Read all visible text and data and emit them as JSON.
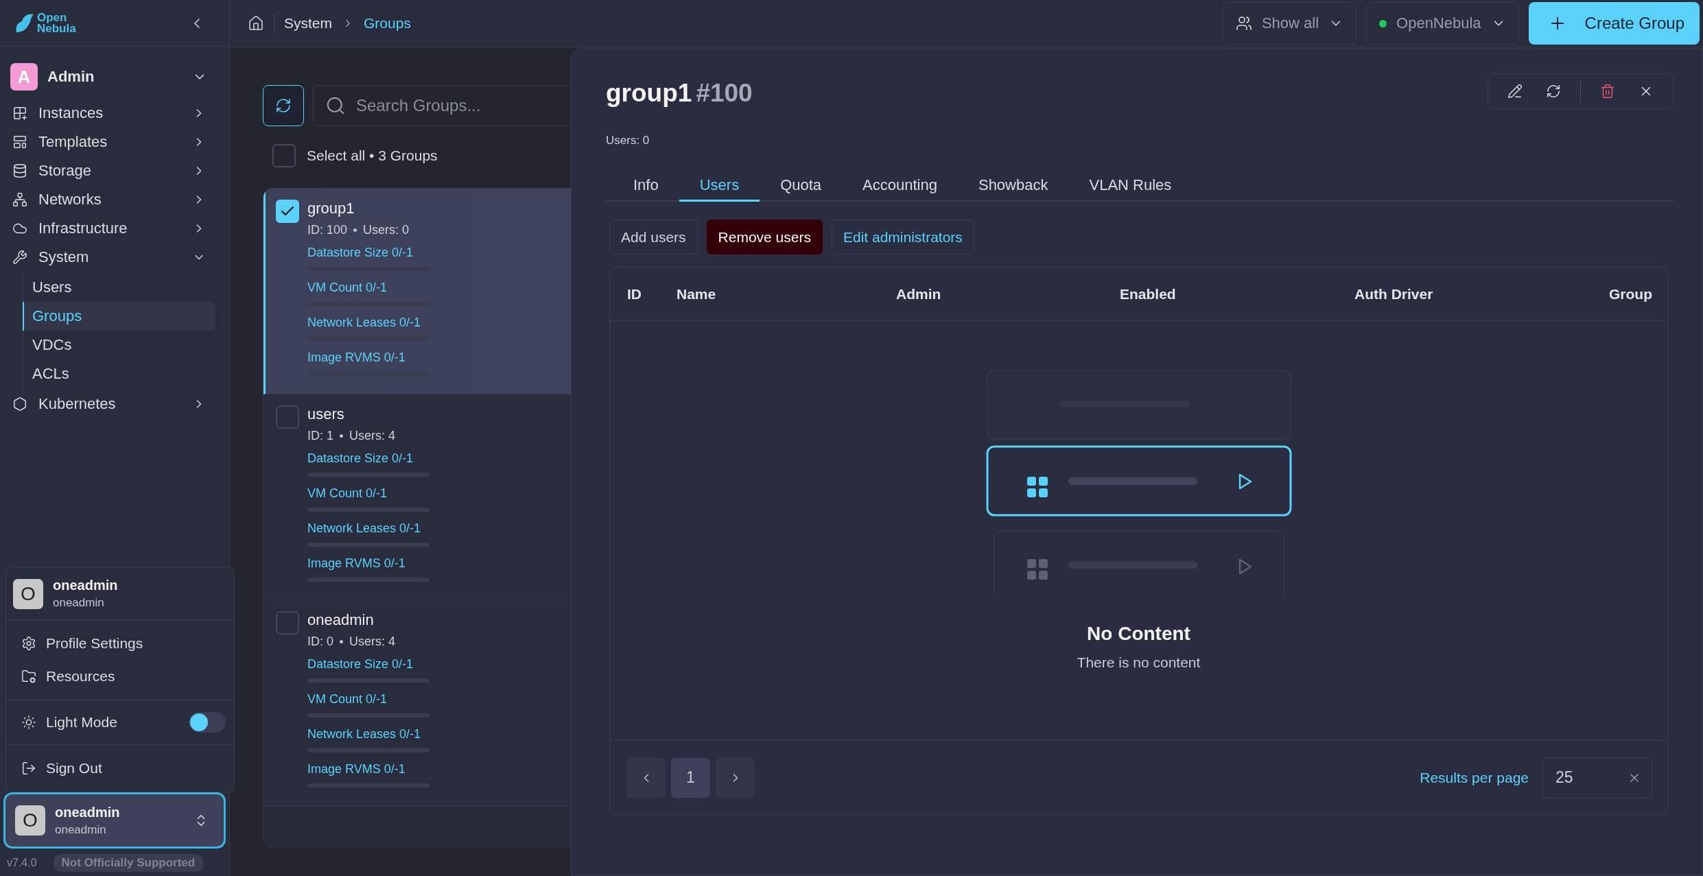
{
  "sidebar": {
    "logo": {
      "line1": "Open",
      "line2": "Nebula"
    },
    "account": {
      "initial": "A",
      "label": "Admin",
      "expanded": true
    },
    "items": [
      {
        "label": "Instances",
        "expanded": false
      },
      {
        "label": "Templates",
        "expanded": false
      },
      {
        "label": "Storage",
        "expanded": false
      },
      {
        "label": "Networks",
        "expanded": false
      },
      {
        "label": "Infrastructure",
        "expanded": false
      },
      {
        "label": "System",
        "expanded": true,
        "children": [
          {
            "label": "Users",
            "selected": false
          },
          {
            "label": "Groups",
            "selected": true
          },
          {
            "label": "VDCs",
            "selected": false
          },
          {
            "label": "ACLs",
            "selected": false
          }
        ]
      },
      {
        "label": "Kubernetes",
        "expanded": false
      }
    ]
  },
  "user_menu": {
    "initial": "O",
    "name": "oneadmin",
    "username": "oneadmin",
    "items": [
      {
        "kind": "link",
        "label": "Profile Settings"
      },
      {
        "kind": "link",
        "label": "Resources"
      },
      {
        "kind": "toggle",
        "label": "Light Mode",
        "on": false
      },
      {
        "kind": "link",
        "label": "Sign Out"
      }
    ]
  },
  "user_button": {
    "initial": "O",
    "name": "oneadmin",
    "username": "oneadmin"
  },
  "footer": {
    "version": "v7.4.0",
    "badge": "Not Officially Supported"
  },
  "breadcrumb": [
    "System",
    "Groups"
  ],
  "toolbar": {
    "filter": "Show all",
    "zone": "OpenNebula",
    "create": "Create Group"
  },
  "list": {
    "search_placeholder": "Search Groups...",
    "select_all": "Select all • 3 Groups",
    "select_all_checked": false,
    "groups": [
      {
        "name": "group1",
        "id": "ID: 100",
        "users": "Users: 0",
        "selected": true,
        "quotas": [
          {
            "label": "Datastore Size 0/-1",
            "level": 0
          },
          {
            "label": "VM Count 0/-1",
            "level": 0
          },
          {
            "label": "Network Leases 0/-1",
            "level": 0
          },
          {
            "label": "Image RVMS 0/-1",
            "level": 0
          }
        ]
      },
      {
        "name": "users",
        "id": "ID: 1",
        "users": "Users: 4",
        "selected": false,
        "quotas": [
          {
            "label": "Datastore Size 0/-1",
            "level": 0
          },
          {
            "label": "VM Count 0/-1",
            "level": 0
          },
          {
            "label": "Network Leases 0/-1",
            "level": 0
          },
          {
            "label": "Image RVMS 0/-1",
            "level": 0
          }
        ]
      },
      {
        "name": "oneadmin",
        "id": "ID: 0",
        "users": "Users: 4",
        "selected": false,
        "quotas": [
          {
            "label": "Datastore Size 0/-1",
            "level": 0
          },
          {
            "label": "VM Count 0/-1",
            "level": 0
          },
          {
            "label": "Network Leases 0/-1",
            "level": 0
          },
          {
            "label": "Image RVMS 0/-1",
            "level": 0
          }
        ]
      }
    ]
  },
  "detail": {
    "title": "group1",
    "number": "#100",
    "summary": "Users: 0",
    "tabs": [
      {
        "label": "Info",
        "selected": false
      },
      {
        "label": "Users",
        "selected": true
      },
      {
        "label": "Quota",
        "selected": false
      },
      {
        "label": "Accounting",
        "selected": false
      },
      {
        "label": "Showback",
        "selected": false
      },
      {
        "label": "VLAN Rules",
        "selected": false
      }
    ],
    "actions": [
      {
        "kind": "neutral",
        "label": "Add users"
      },
      {
        "kind": "danger",
        "label": "Remove users"
      },
      {
        "kind": "primary",
        "label": "Edit administrators"
      }
    ],
    "table": {
      "columns": [
        "ID",
        "Name",
        "Admin",
        "Enabled",
        "Auth Driver",
        "Group"
      ],
      "empty_title": "No Content",
      "empty_text": "There is no content"
    },
    "pagination": {
      "pages": [
        {
          "label": "1",
          "selected": true
        }
      ],
      "per_page_label": "Results per page",
      "per_page": "25"
    }
  }
}
